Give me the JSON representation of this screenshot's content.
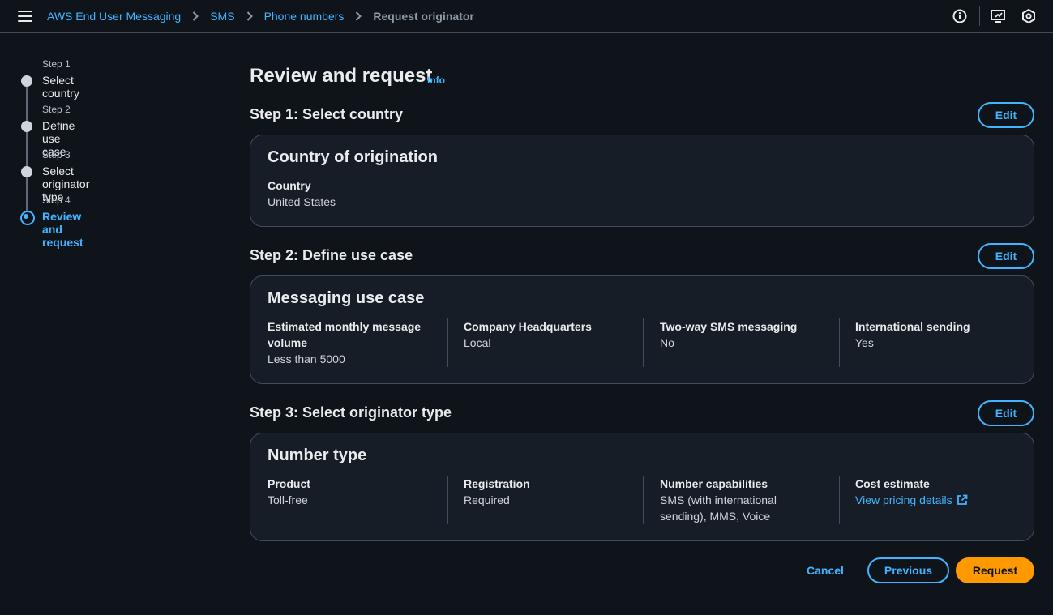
{
  "breadcrumb": {
    "items": [
      "AWS End User Messaging",
      "SMS",
      "Phone numbers"
    ],
    "current": "Request originator"
  },
  "steps": [
    {
      "small": "Step 1",
      "label": "Select country"
    },
    {
      "small": "Step 2",
      "label": "Define use case"
    },
    {
      "small": "Step 3",
      "label": "Select originator type"
    },
    {
      "small": "Step 4",
      "label": "Review and request"
    }
  ],
  "main": {
    "title": "Review and request",
    "info": "Info",
    "edit_label": "Edit",
    "sections": [
      {
        "heading": "Step 1: Select country",
        "card_title": "Country of origination",
        "fields": [
          {
            "key": "Country",
            "value": "United States"
          }
        ]
      },
      {
        "heading": "Step 2: Define use case",
        "card_title": "Messaging use case",
        "fields": [
          {
            "key": "Estimated monthly message volume",
            "value": "Less than 5000"
          },
          {
            "key": "Company Headquarters",
            "value": "Local"
          },
          {
            "key": "Two-way SMS messaging",
            "value": "No"
          },
          {
            "key": "International sending",
            "value": "Yes"
          }
        ]
      },
      {
        "heading": "Step 3: Select originator type",
        "card_title": "Number type",
        "fields": [
          {
            "key": "Product",
            "value": "Toll-free"
          },
          {
            "key": "Registration",
            "value": "Required"
          },
          {
            "key": "Number capabilities",
            "value": "SMS (with international sending), MMS, Voice"
          },
          {
            "key": "Cost estimate",
            "value": "View pricing details"
          }
        ]
      }
    ]
  },
  "footer": {
    "cancel": "Cancel",
    "previous": "Previous",
    "request": "Request"
  },
  "colors": {
    "background": "#0f141a",
    "link": "#42b4ff",
    "primary_button": "#ff9900",
    "border": "#414d5c"
  },
  "icons": [
    "menu-icon",
    "chevron-right-icon",
    "info-circle-icon",
    "screen-icon",
    "settings-icon",
    "external-link-icon"
  ]
}
